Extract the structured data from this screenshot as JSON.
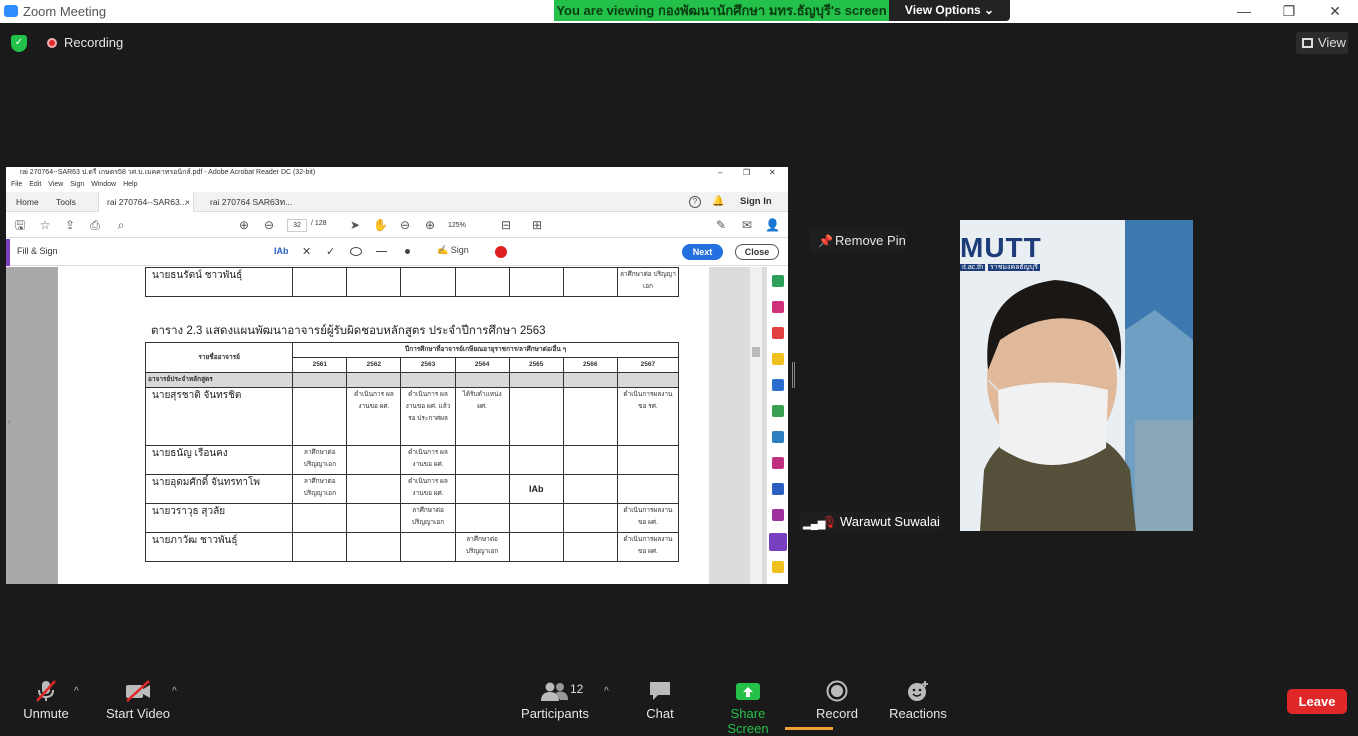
{
  "window": {
    "title": "Zoom Meeting",
    "minimize": "—",
    "maximize": "❐",
    "close": "✕"
  },
  "banner": {
    "viewing": "You are viewing กองพัฒนานักศึกษา มทร.ธัญบุรี's screen",
    "view_options": "View Options ⌄"
  },
  "meeting": {
    "recording": "Recording",
    "view": "View"
  },
  "acrobat": {
    "title": "rai 270764--SAR63 ป.ตรี เกษตร58 วศ.บ.เมคคาทรอนิกส์.pdf - Adobe Acrobat Reader DC (32-bit)",
    "menu": [
      "File",
      "Edit",
      "View",
      "Sign",
      "Window",
      "Help"
    ],
    "tabs": {
      "home": "Home",
      "tools": "Tools",
      "doc1": "rai 270764--SAR63...",
      "doc1_close": "×",
      "doc2": "rai 270764 SAR63ท..."
    },
    "sign_in": "Sign In",
    "page_current": "32",
    "page_total": "/ 128",
    "zoom": "125%",
    "fill_sign": {
      "label": "Fill & Sign",
      "text_tool": "IAb",
      "sign": "Sign",
      "next": "Next",
      "close": "Close"
    }
  },
  "document": {
    "top_row": {
      "name": "นายธนรัตน์ ชาวพันธุ์",
      "note": "ลาศึกษาต่อ ปริญญาเอก"
    },
    "caption": "ตาราง 2.3 แสดงแผนพัฒนาอาจารย์ผู้รับผิดชอบหลักสูตร ประจำปีการศึกษา 2563",
    "header_name": "รายชื่ออาจารย์",
    "header_plan": "ปีการศึกษาที่อาจารย์เกษียณอายุราชการ/ลาศึกษาต่อ/อื่น ๆ",
    "years": [
      "2561",
      "2562",
      "2563",
      "2564",
      "2565",
      "2566",
      "2567"
    ],
    "section": "อาจารย์ประจำหลักสูตร",
    "rows": [
      {
        "name": "นายสุรชาติ จันทรชิต",
        "cells": [
          "",
          "ดำเนินการ ผลงานขอ ผศ.",
          "ดำเนินการ ผลงานขอ ผศ. แล้ว รอ ประกาศผล",
          "ได้รับตำแหน่ง ผศ.",
          "",
          "",
          "ดำเนินการผลงาน ขอ รศ."
        ]
      },
      {
        "name": "นายธนัญ เรือนคง",
        "cells": [
          "ลาศึกษาต่อ ปริญญาเอก",
          "",
          "ดำเนินการ ผลงานขอ ผศ.",
          "",
          "",
          "",
          ""
        ]
      },
      {
        "name": "นายอุดมศักดิ์ จันทรทาโพ",
        "cells": [
          "ลาศึกษาต่อ ปริญญาเอก",
          "",
          "ดำเนินการ ผลงานขอ ผศ.",
          "",
          "IAb",
          "",
          ""
        ]
      },
      {
        "name": "นายวราวุธ สุวลัย",
        "cells": [
          "",
          "",
          "ลาศึกษาต่อ ปริญญาเอก",
          "",
          "",
          "",
          "ดำเนินการผลงาน ขอ ผศ."
        ]
      },
      {
        "name": "นายภาวัฒ ชาวพันธุ์",
        "cells": [
          "",
          "",
          "",
          "ลาศึกษาต่อ ปริญญาเอก",
          "",
          "",
          "ดำเนินการผลงาน ขอ ผศ."
        ]
      }
    ]
  },
  "participant": {
    "remove_pin": "Remove Pin",
    "name": "Warawut Suwalai",
    "logo_text": "MUTT",
    "logo_sub": "ราชมงคลธัญบุรี",
    "logo_url_part": "ıt.ac.th"
  },
  "controls": {
    "unmute": "Unmute",
    "start_video": "Start Video",
    "participants": "Participants",
    "participants_count": "12",
    "chat": "Chat",
    "share_screen": "Share Screen",
    "record": "Record",
    "reactions": "Reactions",
    "leave": "Leave",
    "caret": "^"
  },
  "colors": {
    "share_green": "#23c04a",
    "leave_red": "#e02828",
    "acrobat_blue": "#2470e0"
  }
}
